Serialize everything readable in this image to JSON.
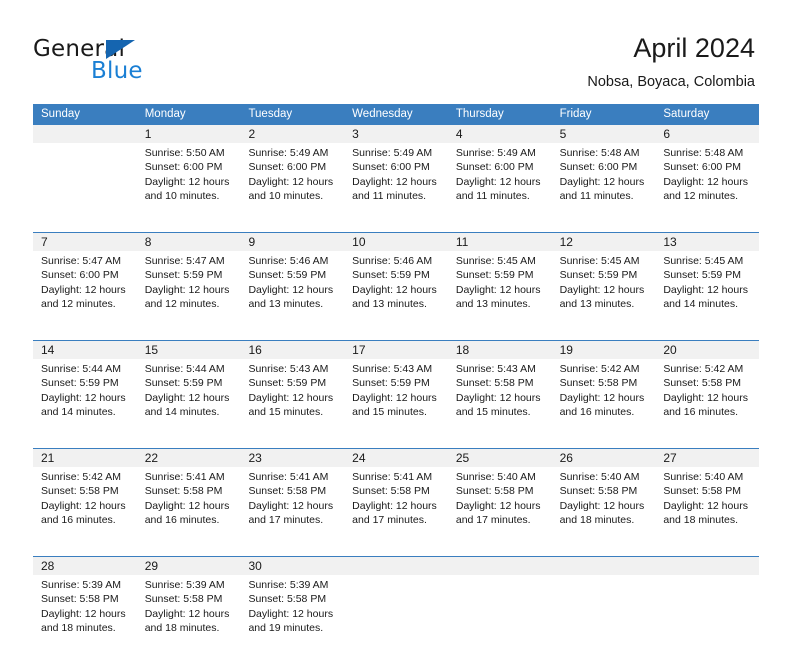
{
  "brand": {
    "name_part1": "General",
    "name_part2": "Blue",
    "logo_icon": "triangle-logo-icon"
  },
  "header": {
    "title": "April 2024",
    "subtitle": "Nobsa, Boyaca, Colombia"
  },
  "colors": {
    "header_blue": "#3a7ebf",
    "daynum_strip": "#f1f1f1",
    "brand_blue": "#1a7fd4",
    "logo_blue": "#1565b0",
    "text": "#1a1a1a"
  },
  "weekday_headers": [
    "Sunday",
    "Monday",
    "Tuesday",
    "Wednesday",
    "Thursday",
    "Friday",
    "Saturday"
  ],
  "weeks": [
    {
      "days": [
        {
          "num": "",
          "lines": [
            "",
            "",
            "",
            ""
          ],
          "empty": true
        },
        {
          "num": "1",
          "lines": [
            "Sunrise: 5:50 AM",
            "Sunset: 6:00 PM",
            "Daylight: 12 hours",
            "and 10 minutes."
          ],
          "empty": false
        },
        {
          "num": "2",
          "lines": [
            "Sunrise: 5:49 AM",
            "Sunset: 6:00 PM",
            "Daylight: 12 hours",
            "and 10 minutes."
          ],
          "empty": false
        },
        {
          "num": "3",
          "lines": [
            "Sunrise: 5:49 AM",
            "Sunset: 6:00 PM",
            "Daylight: 12 hours",
            "and 11 minutes."
          ],
          "empty": false
        },
        {
          "num": "4",
          "lines": [
            "Sunrise: 5:49 AM",
            "Sunset: 6:00 PM",
            "Daylight: 12 hours",
            "and 11 minutes."
          ],
          "empty": false
        },
        {
          "num": "5",
          "lines": [
            "Sunrise: 5:48 AM",
            "Sunset: 6:00 PM",
            "Daylight: 12 hours",
            "and 11 minutes."
          ],
          "empty": false
        },
        {
          "num": "6",
          "lines": [
            "Sunrise: 5:48 AM",
            "Sunset: 6:00 PM",
            "Daylight: 12 hours",
            "and 12 minutes."
          ],
          "empty": false
        }
      ]
    },
    {
      "days": [
        {
          "num": "7",
          "lines": [
            "Sunrise: 5:47 AM",
            "Sunset: 6:00 PM",
            "Daylight: 12 hours",
            "and 12 minutes."
          ],
          "empty": false
        },
        {
          "num": "8",
          "lines": [
            "Sunrise: 5:47 AM",
            "Sunset: 5:59 PM",
            "Daylight: 12 hours",
            "and 12 minutes."
          ],
          "empty": false
        },
        {
          "num": "9",
          "lines": [
            "Sunrise: 5:46 AM",
            "Sunset: 5:59 PM",
            "Daylight: 12 hours",
            "and 13 minutes."
          ],
          "empty": false
        },
        {
          "num": "10",
          "lines": [
            "Sunrise: 5:46 AM",
            "Sunset: 5:59 PM",
            "Daylight: 12 hours",
            "and 13 minutes."
          ],
          "empty": false
        },
        {
          "num": "11",
          "lines": [
            "Sunrise: 5:45 AM",
            "Sunset: 5:59 PM",
            "Daylight: 12 hours",
            "and 13 minutes."
          ],
          "empty": false
        },
        {
          "num": "12",
          "lines": [
            "Sunrise: 5:45 AM",
            "Sunset: 5:59 PM",
            "Daylight: 12 hours",
            "and 13 minutes."
          ],
          "empty": false
        },
        {
          "num": "13",
          "lines": [
            "Sunrise: 5:45 AM",
            "Sunset: 5:59 PM",
            "Daylight: 12 hours",
            "and 14 minutes."
          ],
          "empty": false
        }
      ]
    },
    {
      "days": [
        {
          "num": "14",
          "lines": [
            "Sunrise: 5:44 AM",
            "Sunset: 5:59 PM",
            "Daylight: 12 hours",
            "and 14 minutes."
          ],
          "empty": false
        },
        {
          "num": "15",
          "lines": [
            "Sunrise: 5:44 AM",
            "Sunset: 5:59 PM",
            "Daylight: 12 hours",
            "and 14 minutes."
          ],
          "empty": false
        },
        {
          "num": "16",
          "lines": [
            "Sunrise: 5:43 AM",
            "Sunset: 5:59 PM",
            "Daylight: 12 hours",
            "and 15 minutes."
          ],
          "empty": false
        },
        {
          "num": "17",
          "lines": [
            "Sunrise: 5:43 AM",
            "Sunset: 5:59 PM",
            "Daylight: 12 hours",
            "and 15 minutes."
          ],
          "empty": false
        },
        {
          "num": "18",
          "lines": [
            "Sunrise: 5:43 AM",
            "Sunset: 5:58 PM",
            "Daylight: 12 hours",
            "and 15 minutes."
          ],
          "empty": false
        },
        {
          "num": "19",
          "lines": [
            "Sunrise: 5:42 AM",
            "Sunset: 5:58 PM",
            "Daylight: 12 hours",
            "and 16 minutes."
          ],
          "empty": false
        },
        {
          "num": "20",
          "lines": [
            "Sunrise: 5:42 AM",
            "Sunset: 5:58 PM",
            "Daylight: 12 hours",
            "and 16 minutes."
          ],
          "empty": false
        }
      ]
    },
    {
      "days": [
        {
          "num": "21",
          "lines": [
            "Sunrise: 5:42 AM",
            "Sunset: 5:58 PM",
            "Daylight: 12 hours",
            "and 16 minutes."
          ],
          "empty": false
        },
        {
          "num": "22",
          "lines": [
            "Sunrise: 5:41 AM",
            "Sunset: 5:58 PM",
            "Daylight: 12 hours",
            "and 16 minutes."
          ],
          "empty": false
        },
        {
          "num": "23",
          "lines": [
            "Sunrise: 5:41 AM",
            "Sunset: 5:58 PM",
            "Daylight: 12 hours",
            "and 17 minutes."
          ],
          "empty": false
        },
        {
          "num": "24",
          "lines": [
            "Sunrise: 5:41 AM",
            "Sunset: 5:58 PM",
            "Daylight: 12 hours",
            "and 17 minutes."
          ],
          "empty": false
        },
        {
          "num": "25",
          "lines": [
            "Sunrise: 5:40 AM",
            "Sunset: 5:58 PM",
            "Daylight: 12 hours",
            "and 17 minutes."
          ],
          "empty": false
        },
        {
          "num": "26",
          "lines": [
            "Sunrise: 5:40 AM",
            "Sunset: 5:58 PM",
            "Daylight: 12 hours",
            "and 18 minutes."
          ],
          "empty": false
        },
        {
          "num": "27",
          "lines": [
            "Sunrise: 5:40 AM",
            "Sunset: 5:58 PM",
            "Daylight: 12 hours",
            "and 18 minutes."
          ],
          "empty": false
        }
      ]
    },
    {
      "days": [
        {
          "num": "28",
          "lines": [
            "Sunrise: 5:39 AM",
            "Sunset: 5:58 PM",
            "Daylight: 12 hours",
            "and 18 minutes."
          ],
          "empty": false
        },
        {
          "num": "29",
          "lines": [
            "Sunrise: 5:39 AM",
            "Sunset: 5:58 PM",
            "Daylight: 12 hours",
            "and 18 minutes."
          ],
          "empty": false
        },
        {
          "num": "30",
          "lines": [
            "Sunrise: 5:39 AM",
            "Sunset: 5:58 PM",
            "Daylight: 12 hours",
            "and 19 minutes."
          ],
          "empty": false
        },
        {
          "num": "",
          "lines": [
            "",
            "",
            "",
            ""
          ],
          "empty": true
        },
        {
          "num": "",
          "lines": [
            "",
            "",
            "",
            ""
          ],
          "empty": true
        },
        {
          "num": "",
          "lines": [
            "",
            "",
            "",
            ""
          ],
          "empty": true
        },
        {
          "num": "",
          "lines": [
            "",
            "",
            "",
            ""
          ],
          "empty": true
        }
      ]
    }
  ]
}
